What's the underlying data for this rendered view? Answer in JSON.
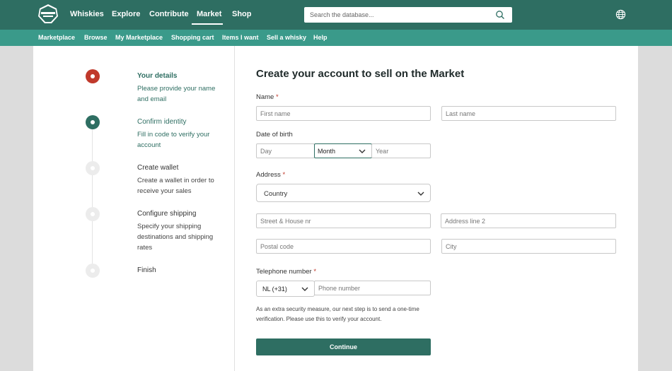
{
  "colors": {
    "primary": "#2e6e62",
    "secondary": "#3a9a8a",
    "active_step": "#c0392b",
    "required": "#c0392b"
  },
  "header": {
    "logo_icon": "whiskybase-logo-icon",
    "nav": [
      {
        "label": "Whiskies"
      },
      {
        "label": "Explore"
      },
      {
        "label": "Contribute"
      },
      {
        "label": "Market"
      },
      {
        "label": "Shop"
      }
    ],
    "active_nav": "Market",
    "search": {
      "placeholder": "Search the database...",
      "icon": "search-icon"
    },
    "globe_icon": "globe-icon"
  },
  "subnav": [
    {
      "label": "Marketplace"
    },
    {
      "label": "Browse"
    },
    {
      "label": "My Marketplace"
    },
    {
      "label": "Shopping cart"
    },
    {
      "label": "Items I want"
    },
    {
      "label": "Sell a whisky"
    },
    {
      "label": "Help"
    }
  ],
  "steps": [
    {
      "title": "Your details",
      "desc": "Please provide your name and email",
      "state": "active"
    },
    {
      "title": "Confirm identity",
      "desc": "Fill in code to verify your account",
      "state": "current"
    },
    {
      "title": "Create wallet",
      "desc": "Create a wallet in order to receive your sales",
      "state": "pending"
    },
    {
      "title": "Configure shipping",
      "desc": "Specify your shipping destinations and shipping rates",
      "state": "pending"
    },
    {
      "title": "Finish",
      "desc": "",
      "state": "pending"
    }
  ],
  "form": {
    "title": "Create your account to sell on the Market",
    "name_label": "Name",
    "first_name_placeholder": "First name",
    "last_name_placeholder": "Last name",
    "dob_label": "Date of birth",
    "day_placeholder": "Day",
    "month_value": "Month",
    "year_placeholder": "Year",
    "address_label": "Address",
    "country_value": "Country",
    "street_placeholder": "Street & House nr",
    "address2_placeholder": "Address line 2",
    "postal_placeholder": "Postal code",
    "city_placeholder": "City",
    "phone_label": "Telephone number",
    "phone_code_value": "NL (+31)",
    "phone_placeholder": "Phone number",
    "required_mark": "*",
    "note": "As an extra security measure, our next step is to send a one-time verification. Please use this to verify your account.",
    "continue_label": "Continue"
  }
}
